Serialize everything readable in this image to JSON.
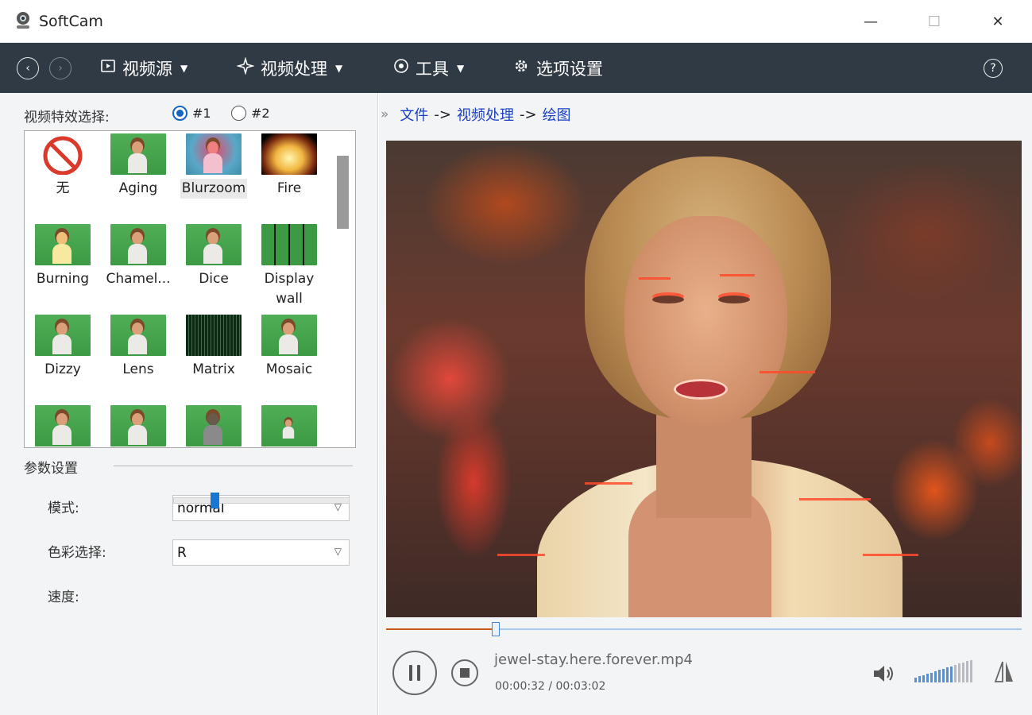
{
  "window": {
    "title": "SoftCam",
    "minimize": "—",
    "maximize": "☐",
    "close": "✕"
  },
  "toolbar": {
    "back": "‹",
    "forward": "›",
    "menus": [
      {
        "label": "视频源",
        "icon": "video-source-icon",
        "has_dropdown": true
      },
      {
        "label": "视频处理",
        "icon": "sparkle-icon",
        "has_dropdown": true
      },
      {
        "label": "工具",
        "icon": "target-icon",
        "has_dropdown": true
      },
      {
        "label": "选项设置",
        "icon": "gear-icon",
        "has_dropdown": false
      }
    ],
    "help": "?"
  },
  "effects_panel": {
    "label": "视频特效选择:",
    "radio_options": [
      {
        "label": "#1",
        "selected": true
      },
      {
        "label": "#2",
        "selected": false
      }
    ],
    "effects": [
      {
        "name": "无",
        "icon": "no-effect-icon"
      },
      {
        "name": "Aging"
      },
      {
        "name": "Blurzoom",
        "selected": true
      },
      {
        "name": "Fire"
      },
      {
        "name": "Burning"
      },
      {
        "name": "Chamel..."
      },
      {
        "name": "Dice"
      },
      {
        "name": "Display\nwall"
      },
      {
        "name": "Dizzy"
      },
      {
        "name": "Lens"
      },
      {
        "name": "Matrix"
      },
      {
        "name": "Mosaic"
      },
      {
        "name": ""
      },
      {
        "name": ""
      },
      {
        "name": ""
      },
      {
        "name": ""
      }
    ]
  },
  "params": {
    "label": "参数设置",
    "mode_label": "模式:",
    "mode_value": "normal",
    "color_label": "色彩选择:",
    "color_value": "R",
    "speed_label": "速度:",
    "speed_fraction": 0.22
  },
  "breadcrumb": {
    "items": [
      "文件",
      "视频处理",
      "绘图"
    ],
    "separator": "->"
  },
  "player": {
    "filename": "jewel-stay.here.forever.mp4",
    "time": "00:00:32 / 00:03:02",
    "progress_fraction": 0.17,
    "volume_level_bars": 10,
    "volume_total_bars": 15,
    "colors": {
      "accent": "#1565c0",
      "progress": "#c8571e",
      "toolbar": "#2f3a45"
    }
  }
}
